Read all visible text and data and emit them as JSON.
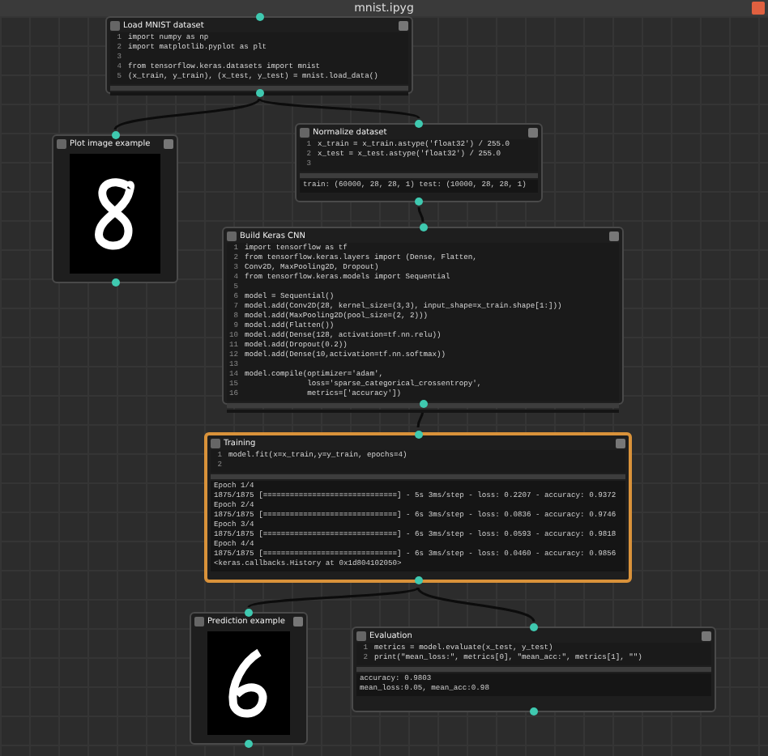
{
  "window": {
    "title": "mnist.ipyg"
  },
  "nodes": [
    {
      "kind": "code",
      "title": "Load MNIST dataset",
      "selected": false,
      "code": [
        {
          "n": "1",
          "text": "import numpy as np"
        },
        {
          "n": "2",
          "text": "import matplotlib.pyplot as plt"
        },
        {
          "n": "3"
        },
        {
          "n": "4",
          "text": "from tensorflow.keras.datasets import mnist"
        },
        {
          "n": "5",
          "text": "(x_train, y_train), (x_test, y_test) = mnist.load_data()"
        }
      ]
    },
    {
      "kind": "image",
      "title": "Plot image example",
      "selected": false
    },
    {
      "kind": "code",
      "title": "Normalize dataset",
      "selected": false,
      "code": [
        {
          "n": "1",
          "text": "x_train = x_train.astype('float32') / 255.0"
        },
        {
          "n": "2",
          "text": "x_test = x_test.astype('float32') / 255.0"
        },
        {
          "n": "3"
        }
      ],
      "output": [
        "train: (60000, 28, 28, 1) test: (10000, 28, 28, 1)"
      ]
    },
    {
      "kind": "code",
      "title": "Build Keras CNN",
      "selected": false,
      "code": [
        {
          "n": "1",
          "text": "import tensorflow as tf"
        },
        {
          "n": "2",
          "text": "from tensorflow.keras.layers import (Dense, Flatten,"
        },
        {
          "n": "3",
          "text": "Conv2D, MaxPooling2D, Dropout)"
        },
        {
          "n": "4",
          "text": "from tensorflow.keras.models import Sequential"
        },
        {
          "n": "5"
        },
        {
          "n": "6",
          "text": "model = Sequential()"
        },
        {
          "n": "7",
          "text": "model.add(Conv2D(28, kernel_size=(3,3), input_shape=x_train.shape[1:]))"
        },
        {
          "n": "8",
          "text": "model.add(MaxPooling2D(pool_size=(2, 2)))"
        },
        {
          "n": "9",
          "text": "model.add(Flatten())"
        },
        {
          "n": "10",
          "text": "model.add(Dense(128, activation=tf.nn.relu))"
        },
        {
          "n": "11",
          "text": "model.add(Dropout(0.2))"
        },
        {
          "n": "12",
          "text": "model.add(Dense(10,activation=tf.nn.softmax))"
        },
        {
          "n": "13"
        },
        {
          "n": "14",
          "text": "model.compile(optimizer='adam',"
        },
        {
          "n": "15",
          "text": "              loss='sparse_categorical_crossentropy',"
        },
        {
          "n": "16",
          "text": "              metrics=['accuracy'])"
        }
      ]
    },
    {
      "kind": "code",
      "title": "Training",
      "selected": true,
      "code": [
        {
          "n": "1",
          "text": "model.fit(x=x_train,y=y_train, epochs=4)"
        },
        {
          "n": "2"
        }
      ],
      "output": [
        "Epoch 1/4",
        "1875/1875 [==============================] - 5s 3ms/step - loss: 0.2207 - accuracy: 0.9372",
        "Epoch 2/4",
        "1875/1875 [==============================] - 6s 3ms/step - loss: 0.0836 - accuracy: 0.9746",
        "Epoch 3/4",
        "1875/1875 [==============================] - 6s 3ms/step - loss: 0.0593 - accuracy: 0.9818",
        "Epoch 4/4",
        "1875/1875 [==============================] - 6s 3ms/step - loss: 0.0460 - accuracy: 0.9856",
        "<keras.callbacks.History at 0x1d804102050>"
      ]
    },
    {
      "kind": "image",
      "title": "Prediction example",
      "selected": false
    },
    {
      "kind": "code",
      "title": "Evaluation",
      "selected": false,
      "code": [
        {
          "n": "1",
          "text": "metrics = model.evaluate(x_test, y_test)"
        },
        {
          "n": "2",
          "text": "print(\"mean_loss:\", metrics[0], \"mean_acc:\", metrics[1], \"\")"
        }
      ],
      "output": [
        "accuracy: 0.9803",
        "mean_loss:0.05, mean_acc:0.98"
      ]
    }
  ]
}
